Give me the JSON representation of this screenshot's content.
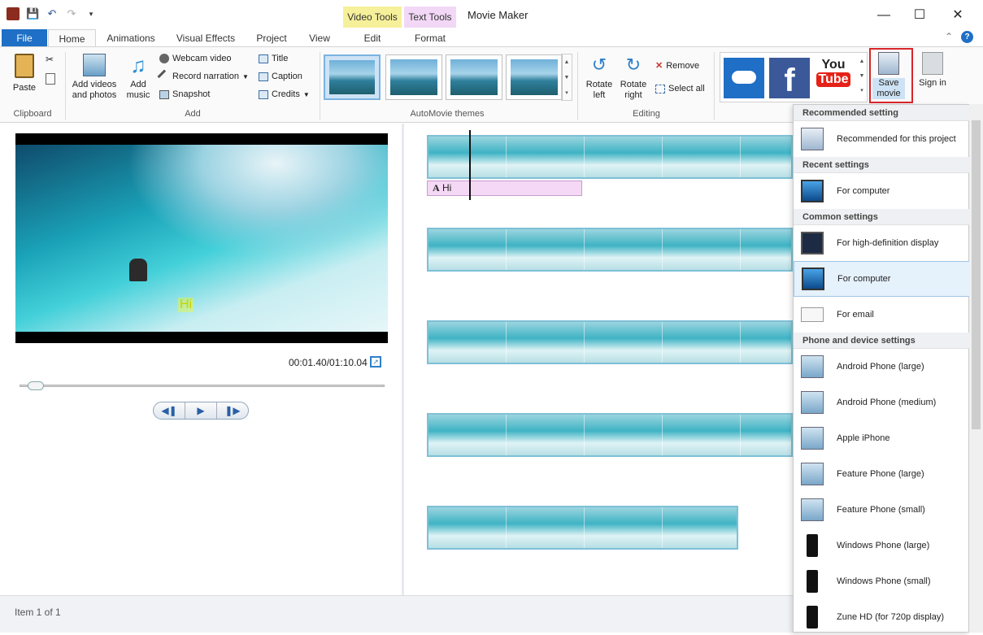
{
  "window": {
    "title": "Movie Maker",
    "context_tabs": {
      "video_tools": "Video Tools",
      "text_tools": "Text Tools"
    },
    "controls": {
      "minimize": "—",
      "maximize": "☐",
      "close": "✕"
    }
  },
  "qat": {
    "icons": [
      "film-icon",
      "save-icon",
      "undo-icon",
      "redo-icon",
      "dropdown-icon"
    ]
  },
  "tabs": [
    {
      "label": "File"
    },
    {
      "label": "Home"
    },
    {
      "label": "Animations"
    },
    {
      "label": "Visual Effects"
    },
    {
      "label": "Project"
    },
    {
      "label": "View"
    },
    {
      "label": "Edit"
    },
    {
      "label": "Format"
    }
  ],
  "ribbon": {
    "clipboard": {
      "label": "Clipboard",
      "paste": "Paste"
    },
    "add": {
      "label": "Add",
      "add_videos": "Add videos and photos",
      "add_music": "Add music",
      "webcam_video": "Webcam video",
      "record_narration": "Record narration",
      "snapshot": "Snapshot",
      "title": "Title",
      "caption": "Caption",
      "credits": "Credits"
    },
    "themes": {
      "label": "AutoMovie themes"
    },
    "editing": {
      "label": "Editing",
      "rotate_left": "Rotate left",
      "rotate_right": "Rotate right",
      "remove": "Remove",
      "select_all": "Select all"
    },
    "share": {
      "save_movie": "Save movie",
      "sign_in": "Sign in",
      "youtube_top": "You",
      "youtube_bottom": "Tube",
      "facebook": "f"
    }
  },
  "preview": {
    "overlay_text": "Hi",
    "timecode": "00:01.40/01:10.04",
    "seek_progress": 0.02
  },
  "storyboard": {
    "caption_clip": "Hi"
  },
  "status": {
    "item_count": "Item 1 of 1"
  },
  "save_menu": {
    "sections": [
      {
        "header": "Recommended setting",
        "items": [
          "Recommended for this project"
        ]
      },
      {
        "header": "Recent settings",
        "items": [
          "For computer"
        ]
      },
      {
        "header": "Common settings",
        "items": [
          "For high-definition display",
          "For computer",
          "For email"
        ]
      },
      {
        "header": "Phone and device settings",
        "items": [
          "Android Phone (large)",
          "Android Phone (medium)",
          "Apple iPhone",
          "Feature Phone (large)",
          "Feature Phone (small)",
          "Windows Phone (large)",
          "Windows Phone (small)",
          "Zune HD (for 720p display)"
        ]
      }
    ]
  },
  "colors": {
    "accent": "#1e6fc5",
    "highlight_box": "#d9262a",
    "caption_clip": "#f4d8f5"
  }
}
